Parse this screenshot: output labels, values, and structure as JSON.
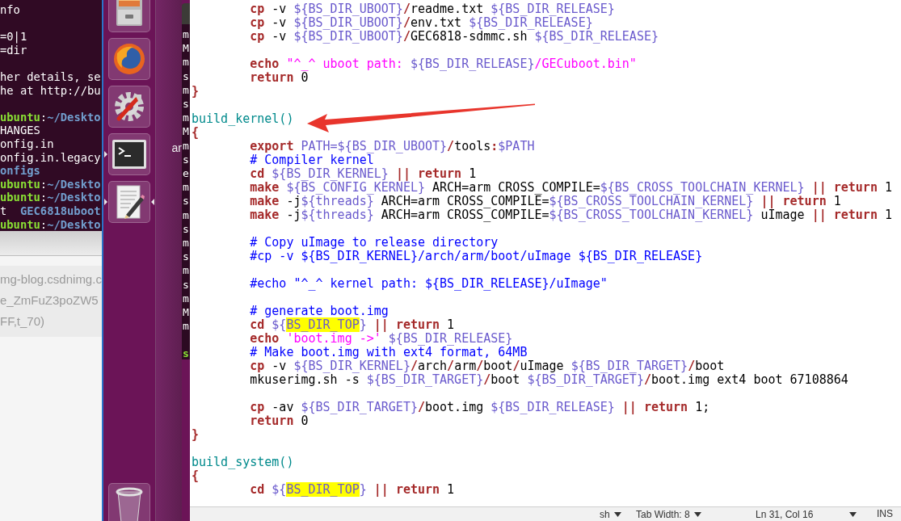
{
  "terminal": {
    "lines": [
      {
        "segments": [
          {
            "kind": "plain",
            "text": "nfo"
          }
        ]
      },
      {
        "blank": true
      },
      {
        "segments": [
          {
            "kind": "plain",
            "text": "=0|1"
          }
        ]
      },
      {
        "segments": [
          {
            "kind": "plain",
            "text": "=dir"
          }
        ]
      },
      {
        "blank": true
      },
      {
        "segments": [
          {
            "kind": "plain",
            "text": "her details, se"
          }
        ]
      },
      {
        "segments": [
          {
            "kind": "plain",
            "text": "he at http://bu"
          }
        ]
      },
      {
        "blank": true
      },
      {
        "segments": [
          {
            "kind": "user",
            "text": "ubuntu"
          },
          {
            "kind": "plain",
            "text": ":"
          },
          {
            "kind": "path",
            "text": "~/Deskto"
          }
        ]
      },
      {
        "segments": [
          {
            "kind": "plain",
            "text": "HANGES"
          }
        ]
      },
      {
        "segments": [
          {
            "kind": "plain",
            "text": "onfig.in"
          }
        ]
      },
      {
        "segments": [
          {
            "kind": "plain",
            "text": "onfig.in.legacy"
          }
        ]
      },
      {
        "segments": [
          {
            "kind": "dir",
            "text": "onfigs"
          }
        ]
      },
      {
        "segments": [
          {
            "kind": "user",
            "text": "ubuntu"
          },
          {
            "kind": "plain",
            "text": ":"
          },
          {
            "kind": "path",
            "text": "~/Deskto"
          }
        ]
      },
      {
        "segments": [
          {
            "kind": "user",
            "text": "ubuntu"
          },
          {
            "kind": "plain",
            "text": ":"
          },
          {
            "kind": "path",
            "text": "~/Deskto"
          }
        ]
      },
      {
        "segments": [
          {
            "kind": "plain",
            "text": "t  "
          },
          {
            "kind": "dir",
            "text": "GEC6818uboot"
          }
        ]
      },
      {
        "segments": [
          {
            "kind": "user",
            "text": "ubuntu"
          },
          {
            "kind": "plain",
            "text": ":"
          },
          {
            "kind": "path",
            "text": "~/Deskto"
          }
        ]
      }
    ]
  },
  "browser_fragment": {
    "lines": [
      "mg-blog.csdnimg.c",
      "e_ZmFuZ3poZW5",
      "FF,t_70)"
    ]
  },
  "launcher": {
    "items": [
      {
        "kind": "cabinet",
        "running": false,
        "focused": false
      },
      {
        "kind": "browser",
        "running": false,
        "focused": false
      },
      {
        "kind": "settings",
        "running": false,
        "focused": false
      },
      {
        "kind": "terminal",
        "running": true,
        "focused": false
      },
      {
        "kind": "editor",
        "running": true,
        "focused": true
      },
      {
        "kind": "trash",
        "running": false,
        "focused": false
      }
    ]
  },
  "desktop": {
    "label": "ar"
  },
  "background_terminal": {
    "lines": [
      "m",
      "M",
      "m",
      "s",
      "m",
      "s",
      "m",
      "M",
      "m",
      "s",
      "e",
      "m",
      "s",
      "m",
      "s",
      "m",
      "s",
      "m",
      "s",
      "m",
      "M",
      "m"
    ],
    "prompt": "s"
  },
  "editor": {
    "lines": [
      {
        "segments": [
          {
            "kind": "kw",
            "text": "\tcp"
          },
          {
            "kind": "plain",
            "text": " -v "
          },
          {
            "kind": "var",
            "text": "${BS_DIR_UBOOT}"
          },
          {
            "kind": "op",
            "text": "/"
          },
          {
            "kind": "plain",
            "text": "readme.txt "
          },
          {
            "kind": "var",
            "text": "${BS_DIR_RELEASE}"
          }
        ]
      },
      {
        "segments": [
          {
            "kind": "kw",
            "text": "\tcp"
          },
          {
            "kind": "plain",
            "text": " -v "
          },
          {
            "kind": "var",
            "text": "${BS_DIR_UBOOT}"
          },
          {
            "kind": "op",
            "text": "/"
          },
          {
            "kind": "plain",
            "text": "env.txt "
          },
          {
            "kind": "var",
            "text": "${BS_DIR_RELEASE}"
          }
        ]
      },
      {
        "segments": [
          {
            "kind": "kw",
            "text": "\tcp"
          },
          {
            "kind": "plain",
            "text": " -v "
          },
          {
            "kind": "var",
            "text": "${BS_DIR_UBOOT}"
          },
          {
            "kind": "op",
            "text": "/"
          },
          {
            "kind": "plain",
            "text": "GEC6818-sdmmc.sh "
          },
          {
            "kind": "var",
            "text": "${BS_DIR_RELEASE}"
          }
        ]
      },
      {
        "blank": true
      },
      {
        "segments": [
          {
            "kind": "kw",
            "text": "\techo "
          },
          {
            "kind": "str",
            "text": "\"^_^ uboot path: "
          },
          {
            "kind": "var",
            "text": "${BS_DIR_RELEASE}"
          },
          {
            "kind": "str",
            "text": "/GECuboot.bin\""
          }
        ]
      },
      {
        "segments": [
          {
            "kind": "kw",
            "text": "\treturn"
          },
          {
            "kind": "plain",
            "text": " 0"
          }
        ]
      },
      {
        "segments": [
          {
            "kind": "brace",
            "text": "}"
          }
        ]
      },
      {
        "blank": true
      },
      {
        "segments": [
          {
            "kind": "fn",
            "text": "build_kernel()"
          }
        ]
      },
      {
        "segments": [
          {
            "kind": "brace",
            "text": "{"
          }
        ]
      },
      {
        "segments": [
          {
            "kind": "kw",
            "text": "\texport "
          },
          {
            "kind": "var",
            "text": "PATH=${BS_DIR_UBOOT}"
          },
          {
            "kind": "op",
            "text": "/"
          },
          {
            "kind": "plain",
            "text": "tools"
          },
          {
            "kind": "op",
            "text": ":"
          },
          {
            "kind": "var",
            "text": "$PATH"
          }
        ]
      },
      {
        "segments": [
          {
            "kind": "cmt",
            "text": "\t# Compiler kernel"
          }
        ]
      },
      {
        "segments": [
          {
            "kind": "kw",
            "text": "\tcd "
          },
          {
            "kind": "var",
            "text": "${BS_DIR_KERNEL} "
          },
          {
            "kind": "op",
            "text": "|| "
          },
          {
            "kind": "kw",
            "text": "return"
          },
          {
            "kind": "plain",
            "text": " 1"
          }
        ]
      },
      {
        "segments": [
          {
            "kind": "kw",
            "text": "\tmake "
          },
          {
            "kind": "var",
            "text": "${BS_CONFIG_KERNEL}"
          },
          {
            "kind": "plain",
            "text": " ARCH=arm CROSS_COMPILE="
          },
          {
            "kind": "var",
            "text": "${BS_CROSS_TOOLCHAIN_KERNEL} "
          },
          {
            "kind": "op",
            "text": "|| "
          },
          {
            "kind": "kw",
            "text": "return"
          },
          {
            "kind": "plain",
            "text": " 1"
          }
        ]
      },
      {
        "segments": [
          {
            "kind": "kw",
            "text": "\tmake"
          },
          {
            "kind": "plain",
            "text": " -j"
          },
          {
            "kind": "var",
            "text": "${threads}"
          },
          {
            "kind": "plain",
            "text": " ARCH=arm CROSS_COMPILE="
          },
          {
            "kind": "var",
            "text": "${BS_CROSS_TOOLCHAIN_KERNEL} "
          },
          {
            "kind": "op",
            "text": "|| "
          },
          {
            "kind": "kw",
            "text": "return"
          },
          {
            "kind": "plain",
            "text": " 1"
          }
        ]
      },
      {
        "segments": [
          {
            "kind": "kw",
            "text": "\tmake"
          },
          {
            "kind": "plain",
            "text": " -j"
          },
          {
            "kind": "var",
            "text": "${threads}"
          },
          {
            "kind": "plain",
            "text": " ARCH=arm CROSS_COMPILE="
          },
          {
            "kind": "var",
            "text": "${BS_CROSS_TOOLCHAIN_KERNEL}"
          },
          {
            "kind": "plain",
            "text": " uImage "
          },
          {
            "kind": "op",
            "text": "|| "
          },
          {
            "kind": "kw",
            "text": "return"
          },
          {
            "kind": "plain",
            "text": " 1"
          }
        ]
      },
      {
        "blank": true
      },
      {
        "segments": [
          {
            "kind": "cmt",
            "text": "\t# Copy uImage to release directory"
          }
        ]
      },
      {
        "segments": [
          {
            "kind": "cmt",
            "text": "\t#cp -v ${BS_DIR_KERNEL}/arch/arm/boot/uImage ${BS_DIR_RELEASE}"
          }
        ]
      },
      {
        "blank": true
      },
      {
        "segments": [
          {
            "kind": "cmt",
            "text": "\t#echo \"^_^ kernel path: ${BS_DIR_RELEASE}/uImage\""
          }
        ]
      },
      {
        "blank": true
      },
      {
        "segments": [
          {
            "kind": "cmt",
            "text": "\t# generate boot.img"
          }
        ]
      },
      {
        "segments": [
          {
            "kind": "kw",
            "text": "\tcd "
          },
          {
            "kind": "var",
            "text": "${"
          },
          {
            "kind": "hl",
            "text": "BS_DIR_TOP"
          },
          {
            "kind": "var",
            "text": "} "
          },
          {
            "kind": "op",
            "text": "|| "
          },
          {
            "kind": "kw",
            "text": "return"
          },
          {
            "kind": "plain",
            "text": " 1"
          }
        ]
      },
      {
        "segments": [
          {
            "kind": "kw",
            "text": "\techo "
          },
          {
            "kind": "str",
            "text": "'boot.img ->' "
          },
          {
            "kind": "var",
            "text": "${BS_DIR_RELEASE}"
          }
        ]
      },
      {
        "segments": [
          {
            "kind": "cmt",
            "text": "\t# Make boot.img with ext4 format, 64MB"
          }
        ]
      },
      {
        "segments": [
          {
            "kind": "kw",
            "text": "\tcp"
          },
          {
            "kind": "plain",
            "text": " -v "
          },
          {
            "kind": "var",
            "text": "${BS_DIR_KERNEL}"
          },
          {
            "kind": "op",
            "text": "/"
          },
          {
            "kind": "plain",
            "text": "arch"
          },
          {
            "kind": "op",
            "text": "/"
          },
          {
            "kind": "plain",
            "text": "arm"
          },
          {
            "kind": "op",
            "text": "/"
          },
          {
            "kind": "plain",
            "text": "boot"
          },
          {
            "kind": "op",
            "text": "/"
          },
          {
            "kind": "plain",
            "text": "uImage "
          },
          {
            "kind": "var",
            "text": "${BS_DIR_TARGET}"
          },
          {
            "kind": "op",
            "text": "/"
          },
          {
            "kind": "plain",
            "text": "boot"
          }
        ]
      },
      {
        "segments": [
          {
            "kind": "plain",
            "text": "\tmkuserimg.sh -s "
          },
          {
            "kind": "var",
            "text": "${BS_DIR_TARGET}"
          },
          {
            "kind": "op",
            "text": "/"
          },
          {
            "kind": "plain",
            "text": "boot "
          },
          {
            "kind": "var",
            "text": "${BS_DIR_TARGET}"
          },
          {
            "kind": "op",
            "text": "/"
          },
          {
            "kind": "plain",
            "text": "boot.img ext4 boot 67108864"
          }
        ]
      },
      {
        "blank": true
      },
      {
        "segments": [
          {
            "kind": "kw",
            "text": "\tcp"
          },
          {
            "kind": "plain",
            "text": " -av "
          },
          {
            "kind": "var",
            "text": "${BS_DIR_TARGET}"
          },
          {
            "kind": "op",
            "text": "/"
          },
          {
            "kind": "plain",
            "text": "boot.img "
          },
          {
            "kind": "var",
            "text": "${BS_DIR_RELEASE} "
          },
          {
            "kind": "op",
            "text": "|| "
          },
          {
            "kind": "kw",
            "text": "return"
          },
          {
            "kind": "plain",
            "text": " 1;"
          }
        ]
      },
      {
        "segments": [
          {
            "kind": "kw",
            "text": "\treturn"
          },
          {
            "kind": "plain",
            "text": " 0"
          }
        ]
      },
      {
        "segments": [
          {
            "kind": "brace",
            "text": "}"
          }
        ]
      },
      {
        "blank": true
      },
      {
        "segments": [
          {
            "kind": "fn",
            "text": "build_system()"
          }
        ]
      },
      {
        "segments": [
          {
            "kind": "brace",
            "text": "{"
          }
        ]
      },
      {
        "segments": [
          {
            "kind": "kw",
            "text": "\tcd "
          },
          {
            "kind": "var",
            "text": "${"
          },
          {
            "kind": "hl",
            "text": "BS_DIR_TOP"
          },
          {
            "kind": "var",
            "text": "} "
          },
          {
            "kind": "op",
            "text": "|| "
          },
          {
            "kind": "kw",
            "text": "return"
          },
          {
            "kind": "plain",
            "text": " 1"
          }
        ]
      }
    ],
    "status_bar": {
      "items": [
        {
          "kind": "dropdown",
          "text": "sh"
        },
        {
          "kind": "dropdown",
          "text": "Tab Width: 8"
        },
        {
          "kind": "dropdown",
          "text": "Ln 31, Col 16"
        },
        {
          "kind": "label",
          "text": "INS"
        }
      ]
    }
  },
  "annotation": {
    "kind": "arrow"
  }
}
